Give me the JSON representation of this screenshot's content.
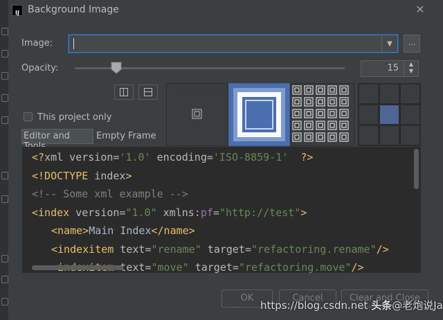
{
  "window": {
    "title": "Background Image",
    "app_icon_text": "IJ"
  },
  "form": {
    "image_label": "Image:",
    "image_value": "",
    "browse_label": "...",
    "opacity_label": "Opacity:",
    "opacity_value": "15",
    "opacity_fraction": 0.15,
    "this_project_only_label": "This project only",
    "this_project_only_checked": false
  },
  "tabs": [
    {
      "label": "Editor and Tools",
      "selected": true
    },
    {
      "label": "Empty Frame",
      "selected": false
    }
  ],
  "editor": {
    "lines": [
      "<?xml version='1.0' encoding='ISO-8859-1'  ?>",
      "<!DOCTYPE index>",
      "<!-- Some xml example -->",
      "<index version=\"1.0\" xmlns:pf=\"http://test\">",
      "<name>Main Index</name>",
      "<indexitem text=\"rename\" target=\"refactoring.rename\"/>",
      "<indexitem text=\"move\" target=\"refactoring.move\"/>"
    ]
  },
  "buttons": {
    "ok": "OK",
    "cancel": "Cancel",
    "clear_close": "Clear and Close"
  },
  "watermark": {
    "url": "https://blog.csdn.net",
    "brand": "头条",
    "handle": "@老炮说Java"
  },
  "colors": {
    "background": "#3c3f41",
    "editor_bg": "#2b2b2b",
    "focus_border": "#3d7bc6",
    "tag": "#e8bf6a",
    "string": "#6a8759",
    "comment": "#808080",
    "selected_cell": "#4f6596"
  }
}
